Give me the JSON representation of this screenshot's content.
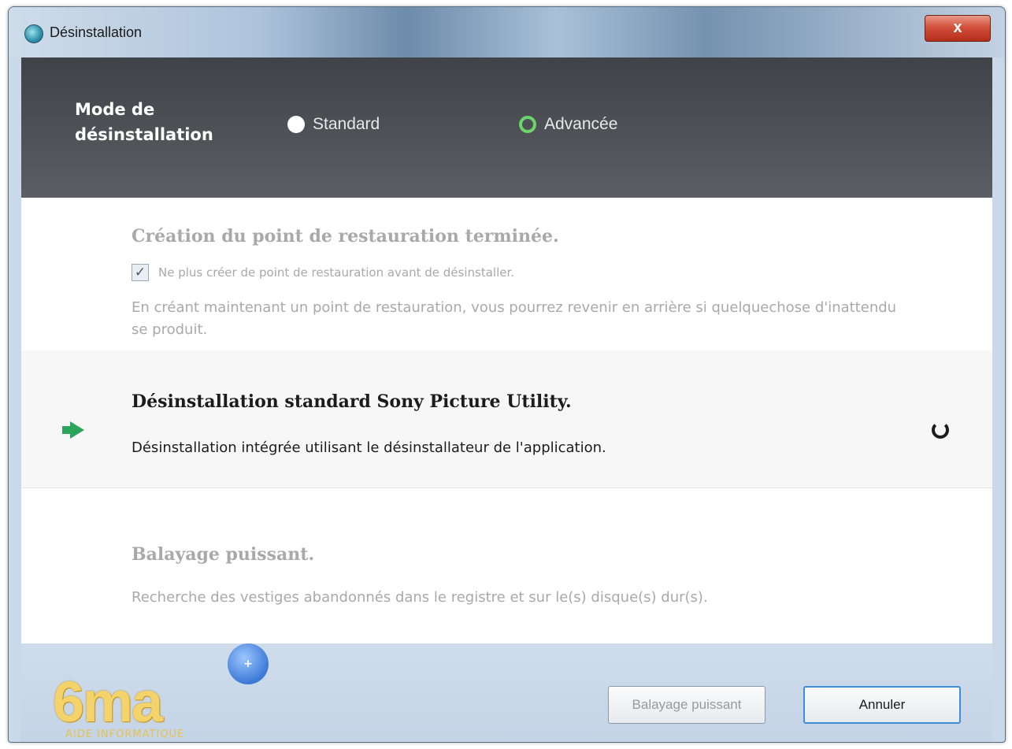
{
  "window": {
    "title": "Désinstallation",
    "close_label": "x"
  },
  "header": {
    "mode_label_line1": "Mode de",
    "mode_label_line2": "désinstallation",
    "options": [
      {
        "label": "Standard",
        "selected": false
      },
      {
        "label": "Advancée",
        "selected": true
      }
    ],
    "accent_color": "#6dd46d"
  },
  "steps": {
    "restore": {
      "title": "Création du point de restauration terminée.",
      "checkbox_label": "Ne plus créer de point de restauration avant de désinstaller.",
      "checkbox_checked": true,
      "description": "En créant maintenant un point de restauration, vous pourrez revenir en arrière si quelquechose d'inattendu se produit."
    },
    "uninstall": {
      "title": "Désinstallation standard Sony Picture Utility.",
      "description": "Désinstallation intégrée utilisant le désinstallateur de l'application.",
      "status_icon": "spinner-icon",
      "active": true
    },
    "scan": {
      "title": "Balayage puissant.",
      "description": "Recherche des vestiges abandonnés dans le registre et sur le(s) disque(s) dur(s)."
    }
  },
  "footer": {
    "logo_text": "6ma",
    "logo_badge": "+",
    "logo_subtext": "AIDE INFORMATIQUE",
    "scan_button": "Balayage puissant",
    "cancel_button": "Annuler"
  }
}
